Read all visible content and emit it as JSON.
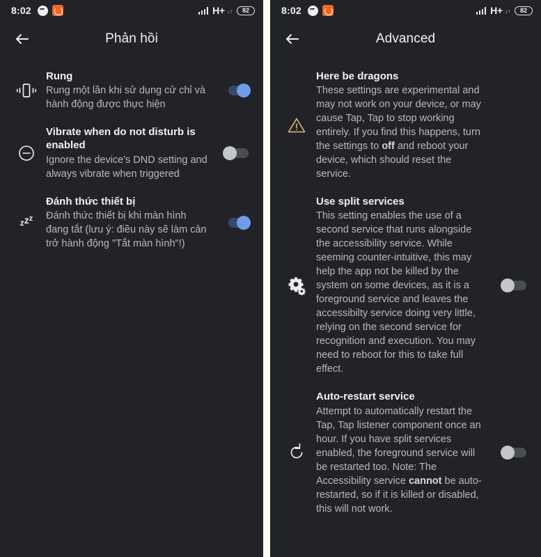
{
  "status_bar": {
    "time": "8:02",
    "left_icons": [
      "messenger-icon",
      "orange-app-icon"
    ],
    "network_type": "H+",
    "network_sub": "↓↑",
    "battery": "82",
    "signal_icon": "signal-bars-icon"
  },
  "left_screen": {
    "title": "Phản hồi",
    "back_icon": "back-arrow-icon",
    "rows": [
      {
        "icon": "vibrate-icon",
        "title": "Rung",
        "subtitle": "Rung một lần khi sử dụng cử chỉ và hành động được thực hiện",
        "toggle": "on"
      },
      {
        "icon": "do-not-disturb-icon",
        "title": "Vibrate when do not disturb is enabled",
        "subtitle": "Ignore the device's DND setting and always vibrate when triggered",
        "toggle": "off"
      },
      {
        "icon": "sleep-zzz-icon",
        "title": "Đánh thức thiết bị",
        "subtitle": "Đánh thức thiết bị khi màn hình đang tắt (lưu ý: điều này sẽ làm cản trở hành động \"Tắt màn hình\"!)",
        "toggle": "on"
      }
    ]
  },
  "right_screen": {
    "title": "Advanced",
    "back_icon": "back-arrow-icon",
    "rows": [
      {
        "icon": "warning-triangle-icon",
        "title": "Here be dragons",
        "subtitle_parts": [
          {
            "text": "These settings are experimental and may not work on your device, or may cause Tap, Tap to stop working entirely. If you find this happens, turn the settings to ",
            "bold": false
          },
          {
            "text": "off",
            "bold": true
          },
          {
            "text": " and reboot your device, which should reset the service.",
            "bold": false
          }
        ],
        "toggle": "none"
      },
      {
        "icon": "gears-icon",
        "title": "Use split services",
        "subtitle_parts": [
          {
            "text": "This setting enables the use of a second service that runs alongside the accessibility service. While seeming counter-intuitive, this may help the app not be killed by the system on some devices, as it is a foreground service and leaves the accessibilty service doing very little, relying on the second service for recognition and execution. You may need to reboot for this to take full effect.",
            "bold": false
          }
        ],
        "toggle": "off"
      },
      {
        "icon": "restart-icon",
        "title": "Auto-restart service",
        "subtitle_parts": [
          {
            "text": "Attempt to automatically restart the Tap, Tap listener component once an hour. If you have split services enabled, the foreground service will be restarted too. Note: The Accessibility service ",
            "bold": false
          },
          {
            "text": "cannot",
            "bold": true
          },
          {
            "text": " be auto-restarted, so if it is killed or disabled, this will not work.",
            "bold": false
          }
        ],
        "toggle": "off"
      }
    ]
  },
  "colors": {
    "background": "#212328",
    "divider": "#fffff8",
    "title_text": "#f1f1f1",
    "body_text": "#b6babf",
    "toggle_on_thumb": "#6f9ce8",
    "toggle_on_track": "#3a4766",
    "toggle_off_thumb": "#c4c6c8",
    "toggle_off_track": "#4a4d52",
    "warning_amber": "#e0bb78",
    "accent_orange": "#f26522"
  }
}
